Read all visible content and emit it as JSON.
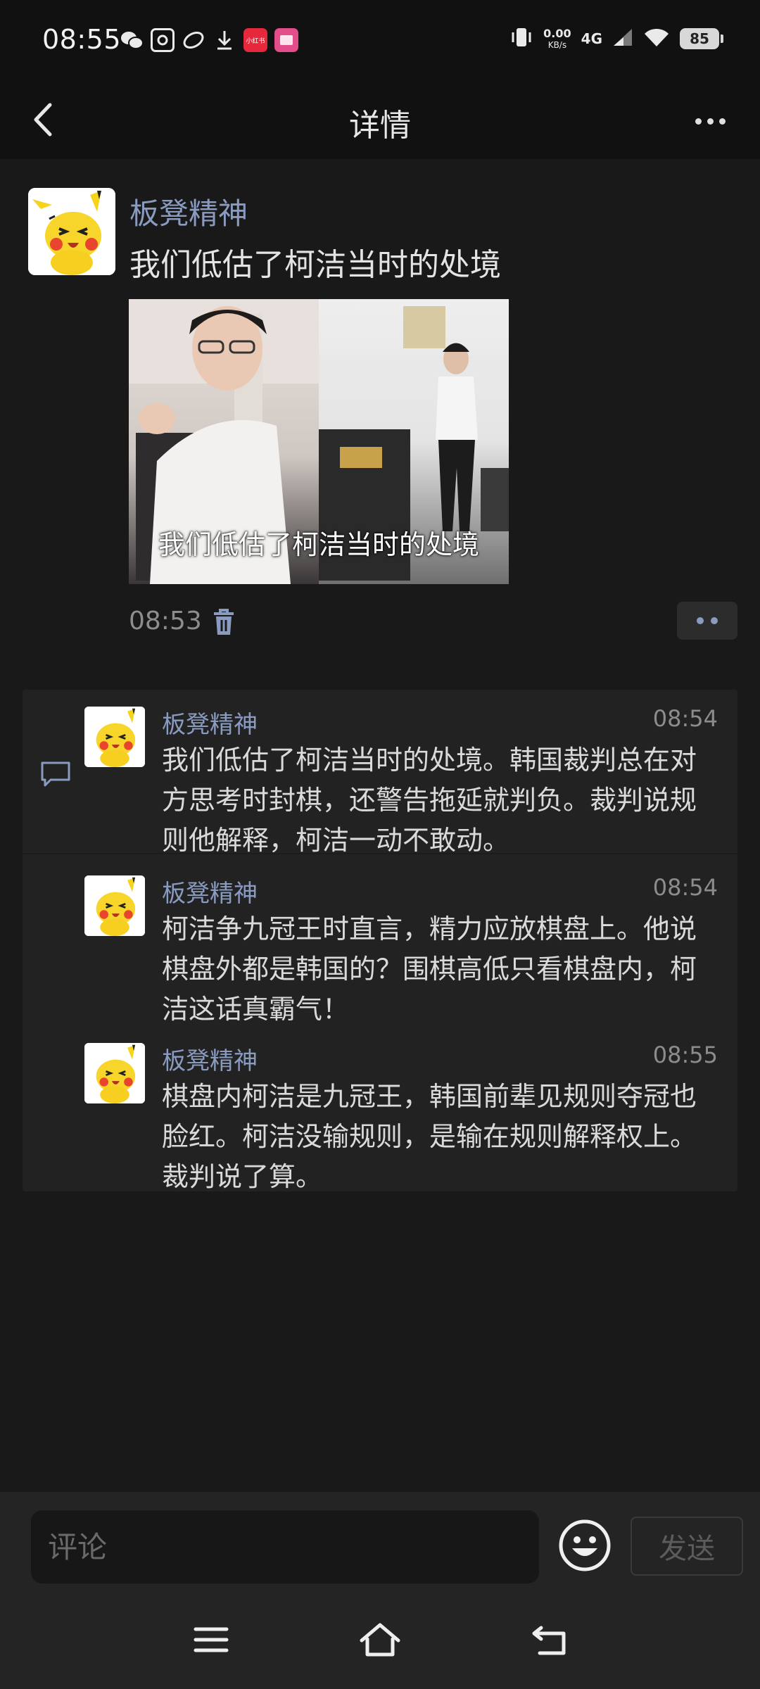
{
  "status_bar": {
    "time": "08:55",
    "app_icons": [
      "wechat-icon",
      "qr-app-icon",
      "link-app-icon",
      "download-icon",
      "xiaohongshu-icon",
      "shop-app-icon"
    ],
    "xiaohongshu_label": "小红书",
    "net_speed_value": "0.00",
    "net_speed_unit": "KB/s",
    "network": "4G",
    "battery": "85"
  },
  "header": {
    "title": "详情"
  },
  "post": {
    "author": "板凳精神",
    "text": "我们低估了柯洁当时的处境",
    "video_caption": "我们低估了柯洁当时的处境",
    "time": "08:53"
  },
  "comments": [
    {
      "author": "板凳精神",
      "time": "08:54",
      "text": " 我们低估了柯洁当时的处境。韩国裁判总在对方思考时封棋，还警告拖延就判负。裁判说规则他解释，柯洁一动不敢动。"
    },
    {
      "author": "板凳精神",
      "time": "08:54",
      "text": "柯洁争九冠王时直言，精力应放棋盘上。他说棋盘外都是韩国的？围棋高低只看棋盘内，柯洁这话真霸气！"
    },
    {
      "author": "板凳精神",
      "time": "08:55",
      "text": " 棋盘内柯洁是九冠王，韩国前辈见规则夺冠也脸红。柯洁没输规则，是输在规则解释权上。裁判说了算。"
    }
  ],
  "input_bar": {
    "placeholder": "评论",
    "send_label": "发送"
  },
  "colors": {
    "background": "#191919",
    "header": "#111111",
    "accent_name": "#8a9bc0",
    "comment_panel": "#222222"
  }
}
